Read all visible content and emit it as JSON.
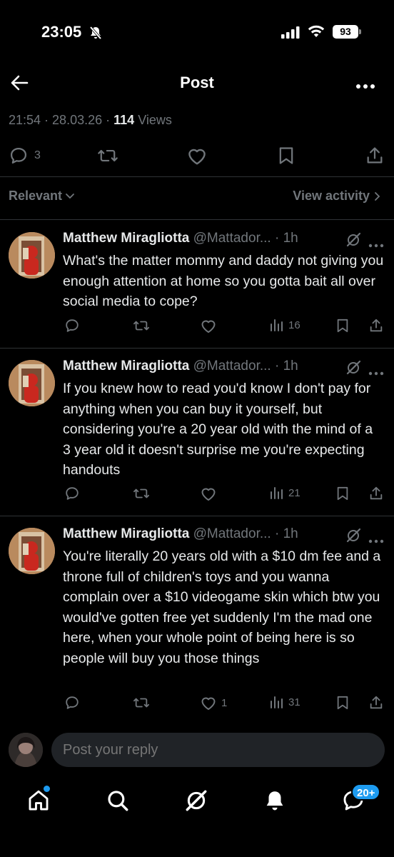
{
  "status_bar": {
    "time": "23:05",
    "battery": "93"
  },
  "header": {
    "title": "Post"
  },
  "post_meta": {
    "time": "21:54",
    "date": "28.03.26",
    "views_count": "114",
    "views_label": "Views"
  },
  "post_actions": {
    "replies": "3"
  },
  "sort": {
    "label": "Relevant",
    "activity_link": "View activity"
  },
  "replies": [
    {
      "name": "Matthew Miragliotta",
      "handle": "@Mattador...",
      "time": "1h",
      "text": "What's the matter mommy and daddy not giving you enough attention at home so you gotta bait all over social media to cope?",
      "likes": "",
      "views": "16"
    },
    {
      "name": "Matthew Miragliotta",
      "handle": "@Mattador...",
      "time": "1h",
      "text": "If you knew how to read you'd know I don't pay for anything when you can buy it yourself, but considering you're a 20 year old with the mind of a 3 year old it doesn't surprise me you're expecting handouts",
      "likes": "",
      "views": "21"
    },
    {
      "name": "Matthew Miragliotta",
      "handle": "@Mattador...",
      "time": "1h",
      "text": "You're literally 20 years old with a $10 dm fee and a throne full of children's toys and you wanna complain over a $10 videogame skin which btw you would've gotten free yet suddenly I'm the mad one here, when your whole point of being here is so people will buy you those things",
      "likes": "1",
      "views": "31"
    }
  ],
  "reply_bar": {
    "placeholder": "Post your reply"
  },
  "tab_bar": {
    "messages_badge": "20+"
  },
  "colors": {
    "background": "#000000",
    "text": "#e7e9ea",
    "muted": "#71767b",
    "accent": "#1d9bf0",
    "divider": "#2f3336"
  }
}
